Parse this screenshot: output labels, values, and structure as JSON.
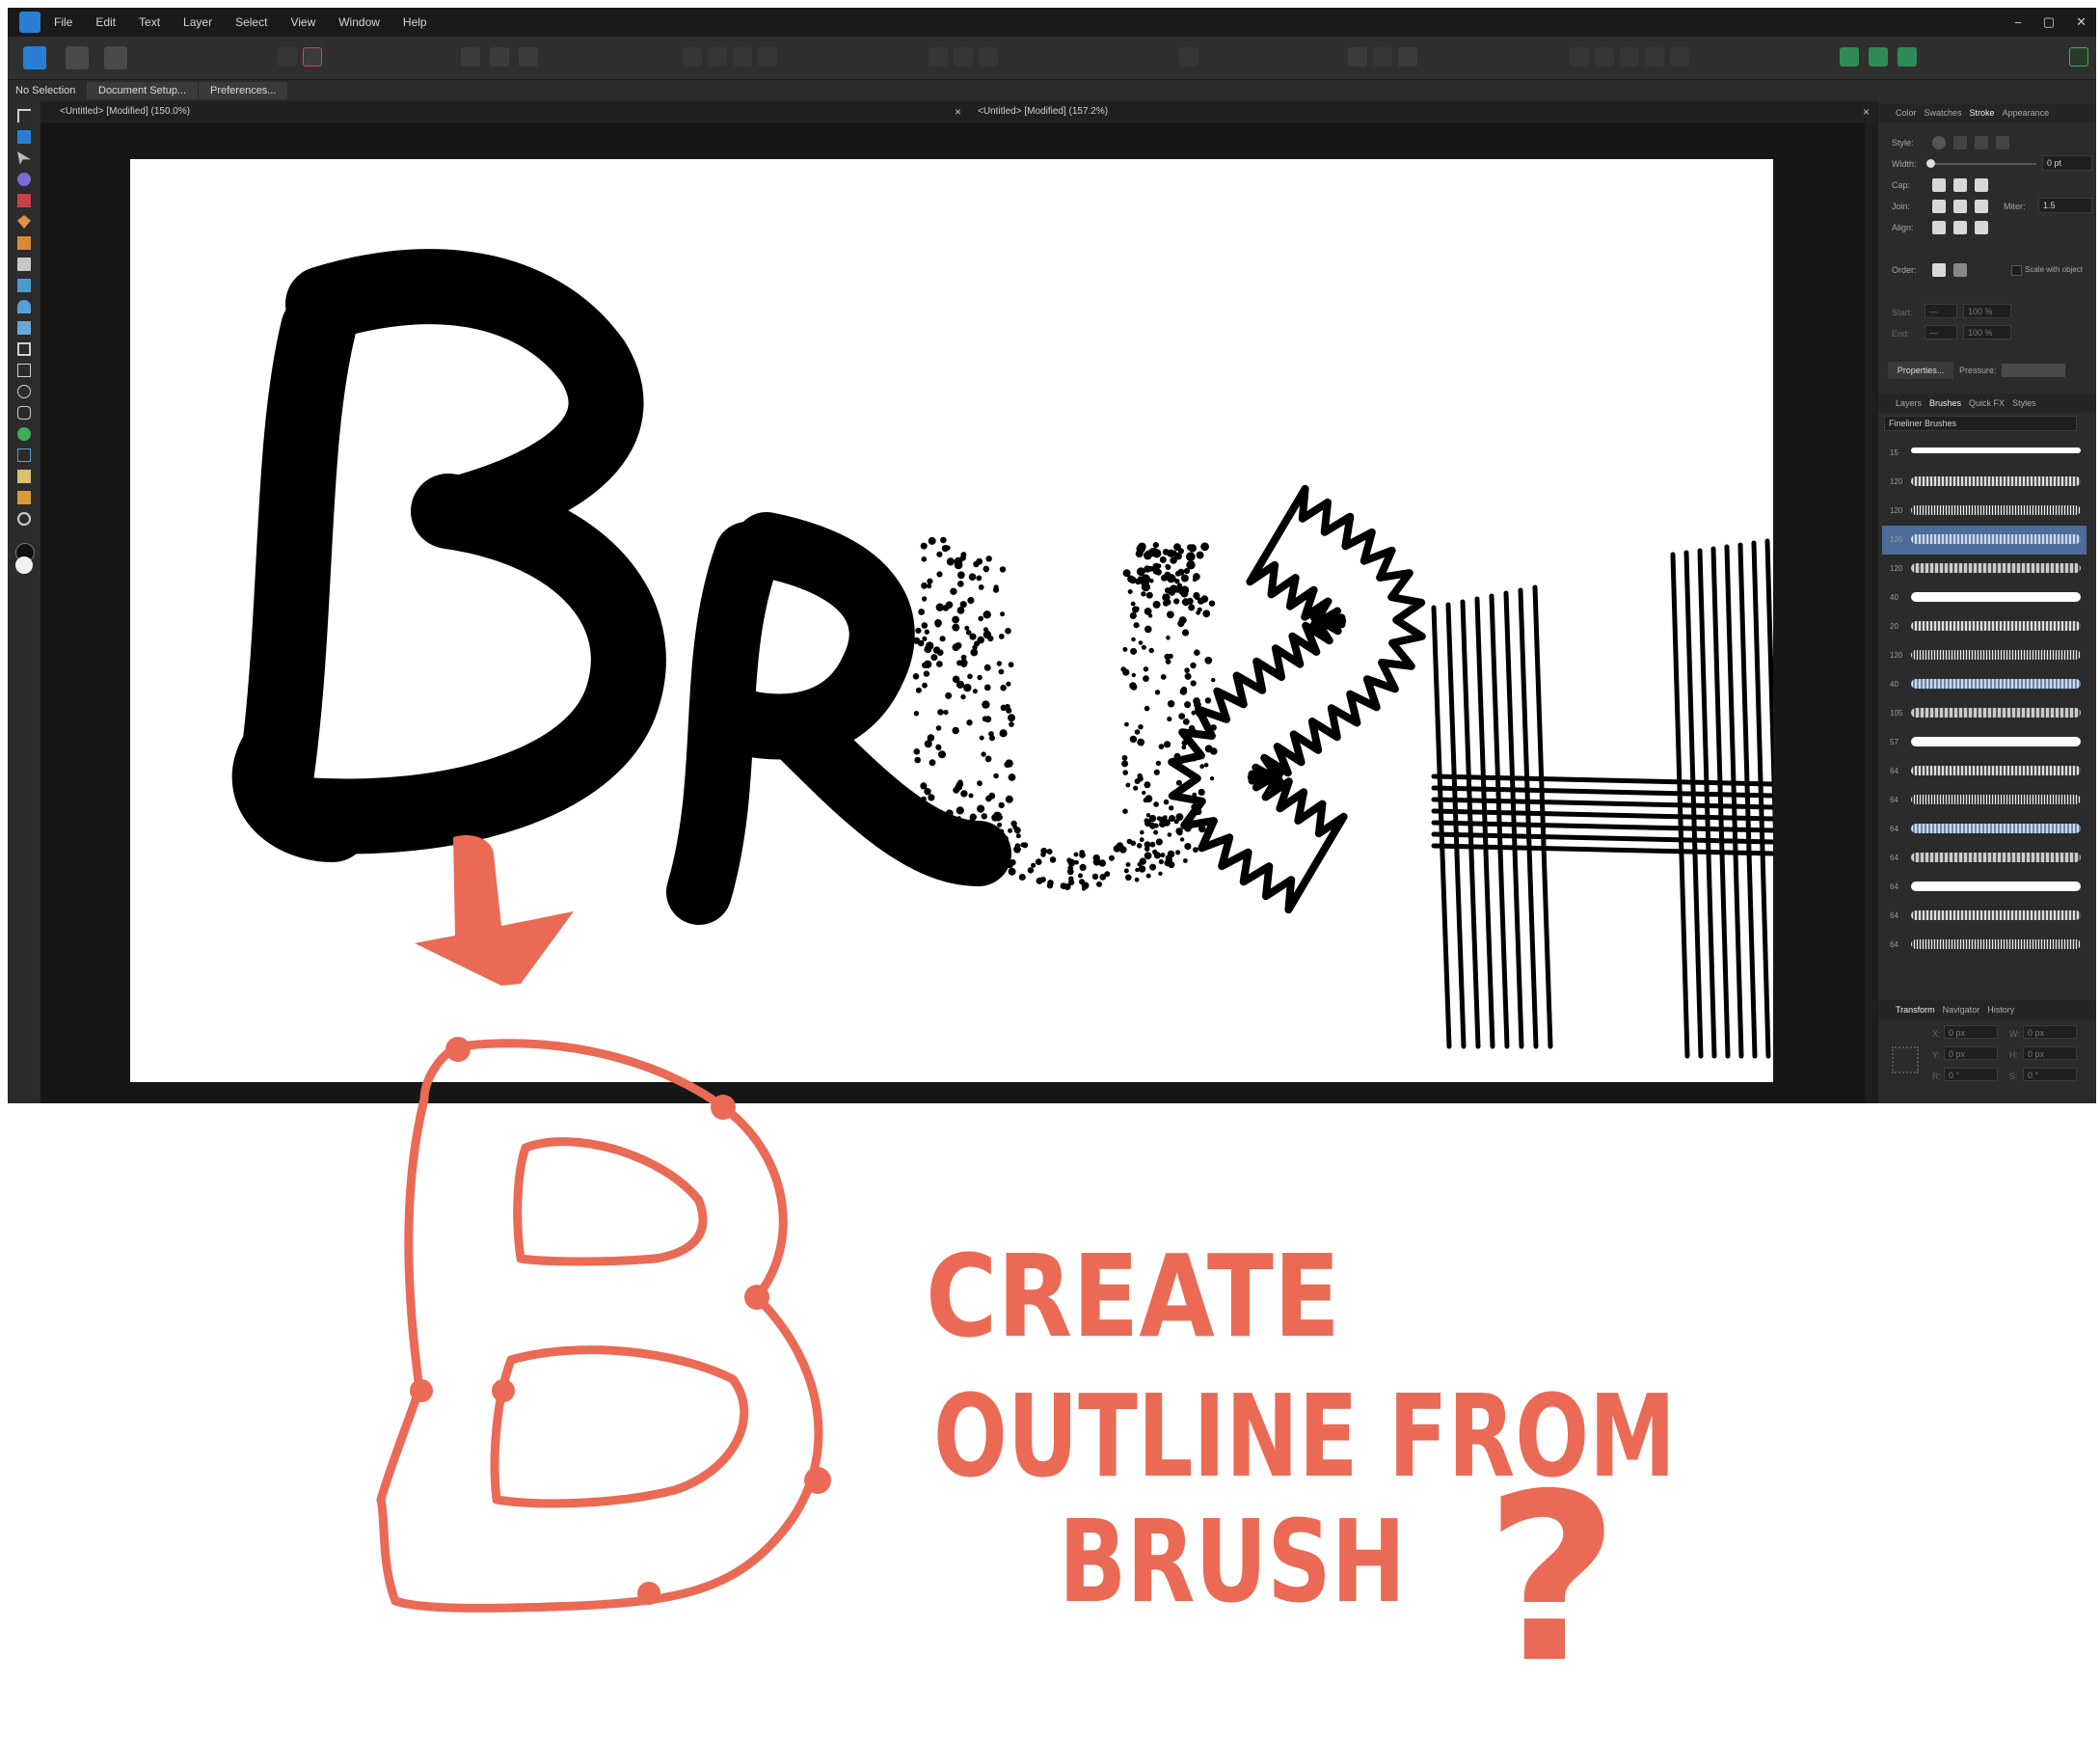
{
  "menubar": {
    "items": [
      "File",
      "Edit",
      "Text",
      "Layer",
      "Select",
      "View",
      "Window",
      "Help"
    ],
    "window_controls": [
      "−",
      "▢",
      "✕"
    ]
  },
  "contextbar": {
    "selection": "No Selection",
    "document_setup": "Document Setup...",
    "preferences": "Preferences..."
  },
  "tabs": [
    {
      "title": "<Untitled> [Modified] (150.0%)",
      "close": "×"
    },
    {
      "title": "<Untitled> [Modified] (157.2%)",
      "close": "×"
    }
  ],
  "stroke_panel": {
    "tabs": [
      "Color",
      "Swatches",
      "Stroke",
      "Appearance"
    ],
    "style_label": "Style:",
    "width_label": "Width:",
    "width_value": "0 pt",
    "cap_label": "Cap:",
    "join_label": "Join:",
    "miter_label": "Miter:",
    "miter_value": "1.5",
    "align_label": "Align:",
    "order_label": "Order:",
    "scale_label": "Scale with object",
    "start_label": "Start:",
    "end_label": "End:",
    "start_pct": "100 %",
    "end_pct": "100 %",
    "properties_button": "Properties...",
    "pressure_label": "Pressure:"
  },
  "brushes_panel": {
    "tabs": [
      "Layers",
      "Brushes",
      "Quick FX",
      "Styles"
    ],
    "category": "Fineliner Brushes",
    "sizes": [
      "15",
      "120",
      "120",
      "120",
      "120",
      "40",
      "20",
      "120",
      "40",
      "105",
      "57",
      "64",
      "64",
      "64",
      "64",
      "64",
      "64",
      "64"
    ],
    "selected_index": 3
  },
  "transform_panel": {
    "tabs": [
      "Transform",
      "Navigator",
      "History"
    ],
    "x_label": "X:",
    "x_value": "0 px",
    "y_label": "Y:",
    "y_value": "0 px",
    "w_label": "W:",
    "w_value": "0 px",
    "h_label": "H:",
    "h_value": "0 px",
    "r_label": "R:",
    "r_value": "0 °",
    "s_label": "S:",
    "s_value": "0 °"
  },
  "annotation": {
    "line1": "CREATE",
    "line2": "OUTLINE FROM",
    "line3": "BRUSH",
    "mark": "?",
    "color": "#ea6a55"
  },
  "colors": {
    "accent_blue": "#2a7fd4",
    "selected_brush": "#4c6d99",
    "annotation": "#ea6a55"
  }
}
